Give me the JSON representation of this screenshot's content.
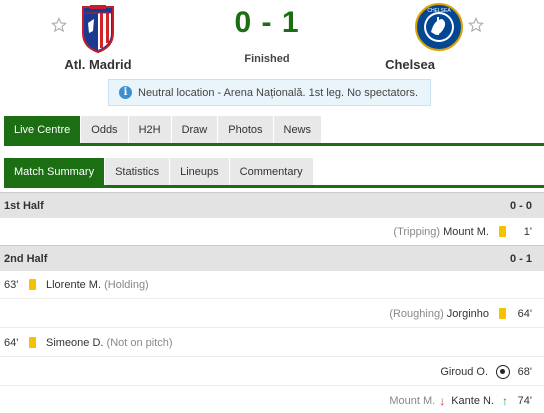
{
  "match": {
    "home_team": "Atl. Madrid",
    "away_team": "Chelsea",
    "score": "0 - 1",
    "status": "Finished",
    "info": "Neutral location - Arena Națională. 1st leg. No spectators."
  },
  "tabs": [
    "Live Centre",
    "Odds",
    "H2H",
    "Draw",
    "Photos",
    "News"
  ],
  "subtabs": [
    "Match Summary",
    "Statistics",
    "Lineups",
    "Commentary"
  ],
  "first_half": {
    "label": "1st Half",
    "score": "0 - 0",
    "events": [
      {
        "note": "(Tripping)",
        "player": "Mount M.",
        "minute": "1'"
      }
    ]
  },
  "second_half": {
    "label": "2nd Half",
    "score": "0 - 1",
    "events": [
      {
        "minute": "63'",
        "player": "Llorente M.",
        "note": "(Holding)"
      },
      {
        "note": "(Roughing)",
        "player": "Jorginho",
        "minute": "64'"
      },
      {
        "minute": "64'",
        "player": "Simeone D.",
        "note": "(Not on pitch)"
      },
      {
        "player": "Giroud O.",
        "minute": "68'"
      },
      {
        "player_out": "Mount M.",
        "player_in": "Kante N.",
        "minute": "74'"
      }
    ]
  },
  "colors": {
    "accent": "#1c6e13",
    "card": "#f4c300"
  }
}
